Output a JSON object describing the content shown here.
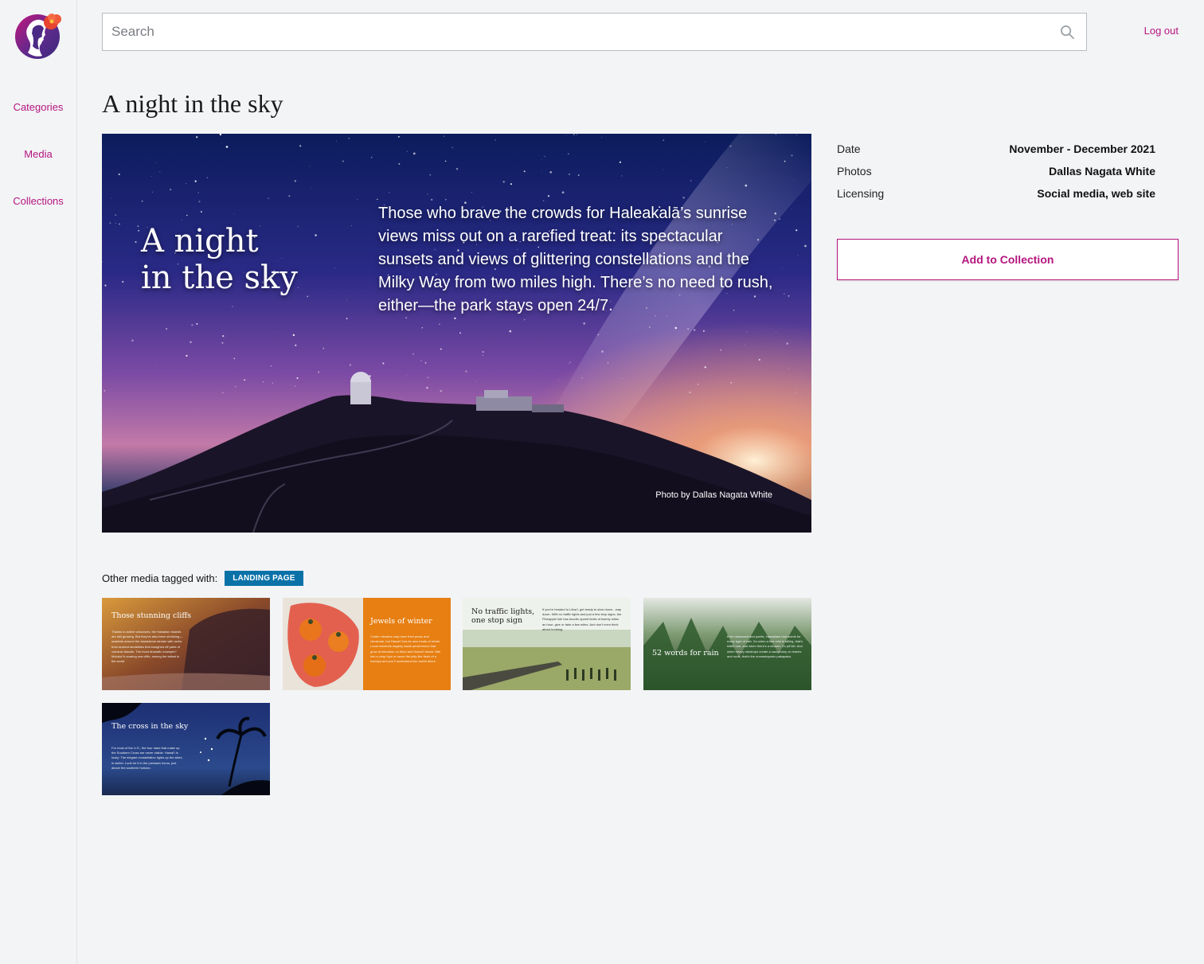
{
  "sidebar": {
    "items": [
      {
        "label": "Categories"
      },
      {
        "label": "Media"
      },
      {
        "label": "Collections"
      }
    ]
  },
  "header": {
    "search_placeholder": "Search",
    "search_value": "",
    "logout_label": "Log out"
  },
  "page": {
    "title": "A night in the sky"
  },
  "hero": {
    "title_line1": "A night",
    "title_line2": "in the sky",
    "text": "Those who brave the crowds for Haleakalā’s sunrise views miss out on a rarefied treat: its spectacular sunsets and views of glittering constellations and the Milky Way from two miles high. There’s no need to rush, either—the park stays open 24/7.",
    "credit": "Photo by Dallas Nagata White"
  },
  "meta": [
    {
      "label": "Date",
      "value": "November - December 2021"
    },
    {
      "label": "Photos",
      "value": "Dallas Nagata White"
    },
    {
      "label": "Licensing",
      "value": "Social media, web site"
    }
  ],
  "add_button_label": "Add to Collection",
  "tagged": {
    "label": "Other media tagged with:",
    "tag": "LANDING PAGE"
  },
  "thumbnails": [
    {
      "title": "Those stunning cliffs",
      "body": "Thanks to active volcanoes, the Hawaiian Islands are still growing. But they've also been shrinking— seabeds around the standalone stream with rocks from ancient landslides that sloughed off parts of volcanic islands. The most dramatic example? Molokaʻi's soaring sea cliffs, among the tallest in the world."
    },
    {
      "title": "Jewels of winter",
      "body": "Colder climates may have their pears and chestnuts, but Hawaiʻi has its own treats of winter. Local residents eagerly await persimmons that grow at elevation on Maui and Hawaiʻi Island. Bite into a crisp fuyu or savor the jelly-like flesh of a hachiya and you'll understand the sweet allure."
    },
    {
      "title": "No traffic lights, one stop sign",
      "body": "If you're headed to Lānaʻi, get ready to slow down…way down. With no traffic lights and just a few stop signs, the Pineapple Isle has bucolic speed limits of twenty miles an hour, give or take a few miles. And don't even think about honking."
    },
    {
      "title": "52 words for rain",
      "body": "Ever observant and poetic, Hawaiians had words for every type of rain. So when a fine mist is falling, that's kilikili noe, and when there's a shower, it's pāʻūkī. And when heavy raindrops create a cacophony on leaves and roofs, that's the onomatopoeic pakapaka."
    },
    {
      "title": "The cross in the sky",
      "body": "For most of the U.S., the four stars that make up the Southern Cross are never visible. Hawaiʻi is lucky: The elegant constellation lights up the skies in winter. Look for it in the predawn hours, just above the southern horizon."
    }
  ],
  "colors": {
    "accent": "#b5157f",
    "tag": "#0b72a8",
    "background": "#f3f4f6"
  }
}
